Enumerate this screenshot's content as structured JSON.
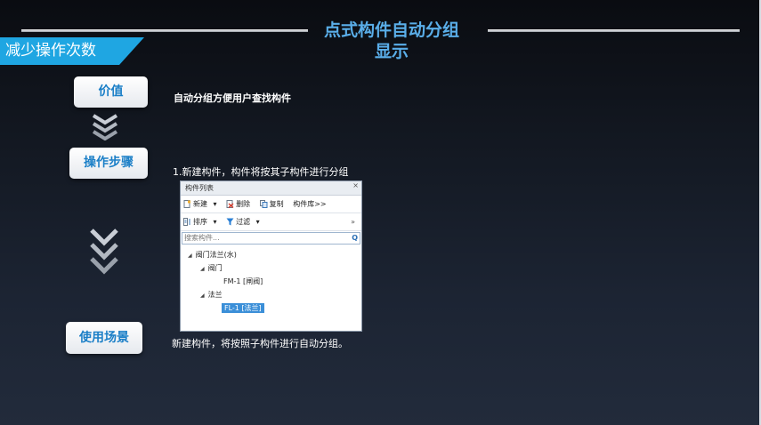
{
  "slide": {
    "title_line1": "点式构件自动分组",
    "title_line2": "显示",
    "banner": "减少操作次数",
    "sections": [
      {
        "label": "价值",
        "description": "自动分组方便用户查找构件"
      },
      {
        "label": "操作步骤",
        "description": "1.新建构件，构件将按其子构件进行分组"
      },
      {
        "label": "使用场景",
        "description": "新建构件，将按照子构件进行自动分组。"
      }
    ]
  },
  "panel": {
    "title": "构件列表",
    "close": "×",
    "toolbar1": {
      "new": "新建",
      "new_arrow": "▾",
      "delete": "删除",
      "copy": "复制",
      "library": "构件库>>"
    },
    "toolbar2": {
      "sort": "排序",
      "sort_arrow": "▾",
      "filter": "过滤",
      "filter_arrow": "▾",
      "more": "»"
    },
    "search_placeholder": "搜索构件...",
    "search_icon": "Q",
    "tree": [
      {
        "label": "阀门法兰(水)",
        "toggle": "◢"
      },
      {
        "label": "阀门",
        "toggle": "◢"
      },
      {
        "label": "FM-1 [闸阀]"
      },
      {
        "label": "法兰",
        "toggle": "◢"
      },
      {
        "label": "FL-1 [法兰]",
        "selected": true
      }
    ]
  },
  "colors": {
    "accent": "#1fa6e2",
    "title": "#5aaee9",
    "pill_text": "#1b7fc7",
    "selection": "#3b8fd8"
  },
  "icons": [
    "chevron-down-icon",
    "new-icon",
    "delete-icon",
    "copy-icon",
    "sort-icon",
    "filter-icon",
    "search-icon"
  ]
}
